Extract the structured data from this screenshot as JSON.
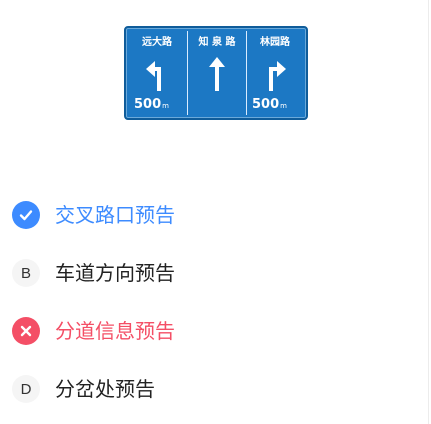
{
  "sign": {
    "background": "#1c78c4",
    "columns": [
      {
        "name": "远大路",
        "arrow": "turn-left-arrow-icon",
        "distance": "500",
        "unit": "m"
      },
      {
        "name": "知 泉 路",
        "arrow": "straight-arrow-icon",
        "distance": "",
        "unit": ""
      },
      {
        "name": "林园路",
        "arrow": "turn-right-arrow-icon",
        "distance": "500",
        "unit": "m"
      }
    ]
  },
  "options": [
    {
      "letter": "A",
      "label": "交叉路口预告",
      "state": "correct",
      "icon": "check-icon",
      "color": "#3d8bff"
    },
    {
      "letter": "B",
      "label": "车道方向预告",
      "state": "normal"
    },
    {
      "letter": "C",
      "label": "分道信息预告",
      "state": "wrong",
      "icon": "cross-icon",
      "color": "#f44f66"
    },
    {
      "letter": "D",
      "label": "分岔处预告",
      "state": "normal"
    }
  ]
}
